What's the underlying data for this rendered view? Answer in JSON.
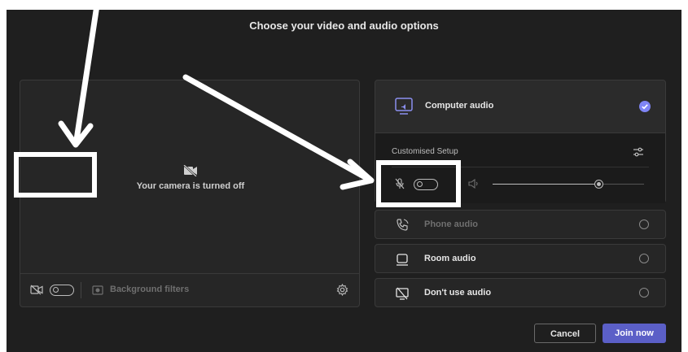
{
  "dialog": {
    "title": "Choose your video and audio options",
    "cancel_label": "Cancel",
    "join_label": "Join now"
  },
  "video": {
    "camera_off_text": "Your camera is turned off",
    "background_filters_label": "Background filters",
    "camera_toggle_on": false
  },
  "audio": {
    "computer_audio_label": "Computer audio",
    "customised_setup_label": "Customised Setup",
    "mic_toggle_on": false,
    "speaker_volume": 0.7,
    "options": [
      {
        "label": "Phone audio",
        "selected": false,
        "enabled": false
      },
      {
        "label": "Room audio",
        "selected": false,
        "enabled": true
      },
      {
        "label": "Don't use audio",
        "selected": false,
        "enabled": true
      }
    ]
  },
  "colors": {
    "accent": "#5b5fc7",
    "background": "#1f1f1f",
    "panel": "#262626",
    "annotation": "#ffffff"
  },
  "icons": [
    "camera-off-icon",
    "camera-icon",
    "background-filter-icon",
    "settings-icon",
    "computer-audio-icon",
    "sliders-icon",
    "mic-off-icon",
    "speaker-icon",
    "phone-icon",
    "room-icon",
    "no-audio-icon",
    "check-icon"
  ]
}
